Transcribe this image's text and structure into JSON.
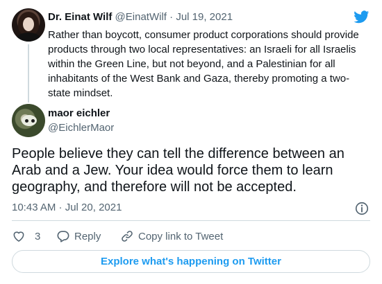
{
  "parent_tweet": {
    "name": "Dr. Einat Wilf",
    "handle": "@EinatWilf",
    "separator": " · ",
    "date": "Jul 19, 2021",
    "text": "Rather than boycott, consumer product corporations should provide products through two local representatives: an Israeli for all Israelis within the Green Line, but not beyond, and a Palestinian for all inhabitants of the West Bank and Gaza, thereby promoting a two-state mindset."
  },
  "main_tweet": {
    "name": "maor eichler",
    "handle": "@EichlerMaor",
    "text": "People believe they can tell the difference between an Arab and a Jew. Your idea would force them to learn geography, and therefore will not be accepted.",
    "timestamp": "10:43 AM · Jul 20, 2021"
  },
  "actions": {
    "like_count": "3",
    "reply_label": "Reply",
    "copy_label": "Copy link to Tweet"
  },
  "explore_label": "Explore what's happening on Twitter",
  "colors": {
    "accent": "#1d9bf0",
    "text": "#0f1419",
    "secondary": "#536471",
    "border": "#cfd9de"
  },
  "icons": [
    "twitter-bird-icon",
    "info-icon",
    "heart-icon",
    "reply-bubble-icon",
    "link-icon"
  ]
}
